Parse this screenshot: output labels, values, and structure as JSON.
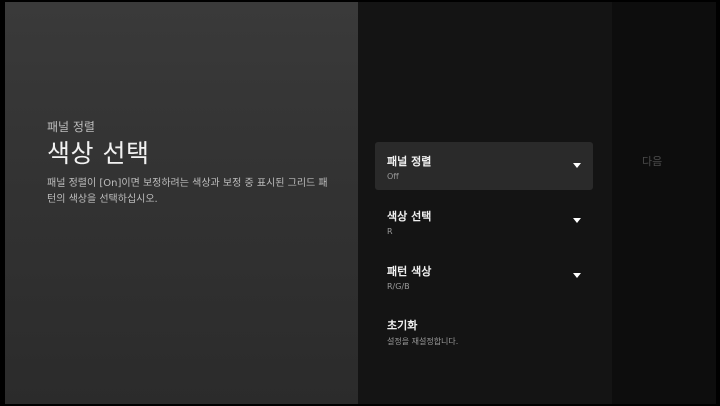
{
  "header": {
    "breadcrumb": "패널 정렬",
    "title": "색상 선택",
    "description": "패널 정렬이 [On]이면 보정하려는 색상과 보정 중 표시된 그리드 패턴의 색상을 선택하십시오."
  },
  "menu": {
    "items": [
      {
        "title": "패널 정렬",
        "value": "Off",
        "icon": "chevron-down-icon"
      },
      {
        "title": "색상 선택",
        "value": "R",
        "icon": "chevron-down-icon"
      },
      {
        "title": "패턴 색상",
        "value": "R/G/B",
        "icon": "chevron-down-icon"
      },
      {
        "title": "초기화",
        "value": "설정을 재설정합니다."
      }
    ]
  },
  "side": {
    "next_label": "다음"
  }
}
